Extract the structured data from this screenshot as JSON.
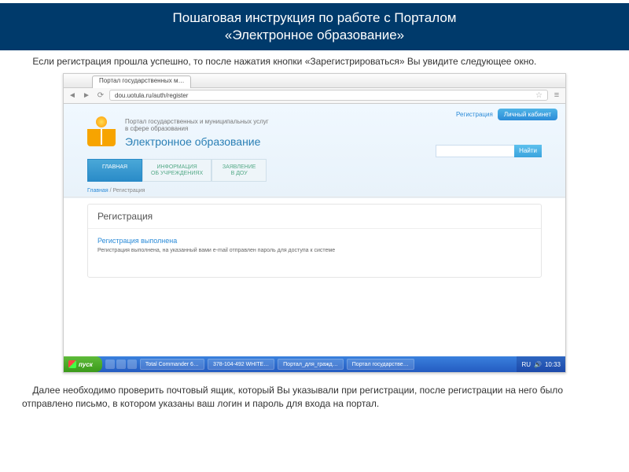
{
  "slide": {
    "title_line1": "Пошаговая инструкция по работе с Порталом",
    "title_line2": "«Электронное образование»",
    "intro": "    Если регистрация прошла успешно, то после нажатия кнопки «Зарегистрироваться» Вы увидите следующее окно.",
    "outro": "    Далее необходимо проверить почтовый ящик, который Вы указывали при регистрации, после регистрации на него было отправлено письмо, в котором указаны ваш логин и пароль для входа на портал."
  },
  "browser": {
    "tab_title": "Портал государственных м…",
    "url": "dou.uotula.ru/auth/register"
  },
  "portal": {
    "top_links": {
      "register": "Регистрация",
      "cabinet": "Личный кабинет"
    },
    "subtitle": "Портал государственных и муниципальных услуг\nв сфере образования",
    "title": "Электронное образование",
    "search_btn": "Найти",
    "tabs": [
      {
        "l1": "ГЛАВНАЯ",
        "l2": ""
      },
      {
        "l1": "ИНФОРМАЦИЯ",
        "l2": "ОБ УЧРЕЖДЕНИЯХ"
      },
      {
        "l1": "ЗАЯВЛЕНИЕ",
        "l2": "В ДОУ"
      }
    ],
    "breadcrumb_home": "Главная",
    "breadcrumb_sep": " / ",
    "breadcrumb_cur": "Регистрация",
    "card_title": "Регистрация",
    "success_title": "Регистрация выполнена",
    "success_body": "Регистрация выполнена, на указанный вами e-mail отправлен пароль для доступа к системе"
  },
  "taskbar": {
    "start": "пуск",
    "items": [
      "Total Commander 6…",
      "378-104-492 WHITE…",
      "Портал_для_гражд…",
      "Портал государстве…"
    ],
    "lang": "RU",
    "time": "10:33"
  }
}
